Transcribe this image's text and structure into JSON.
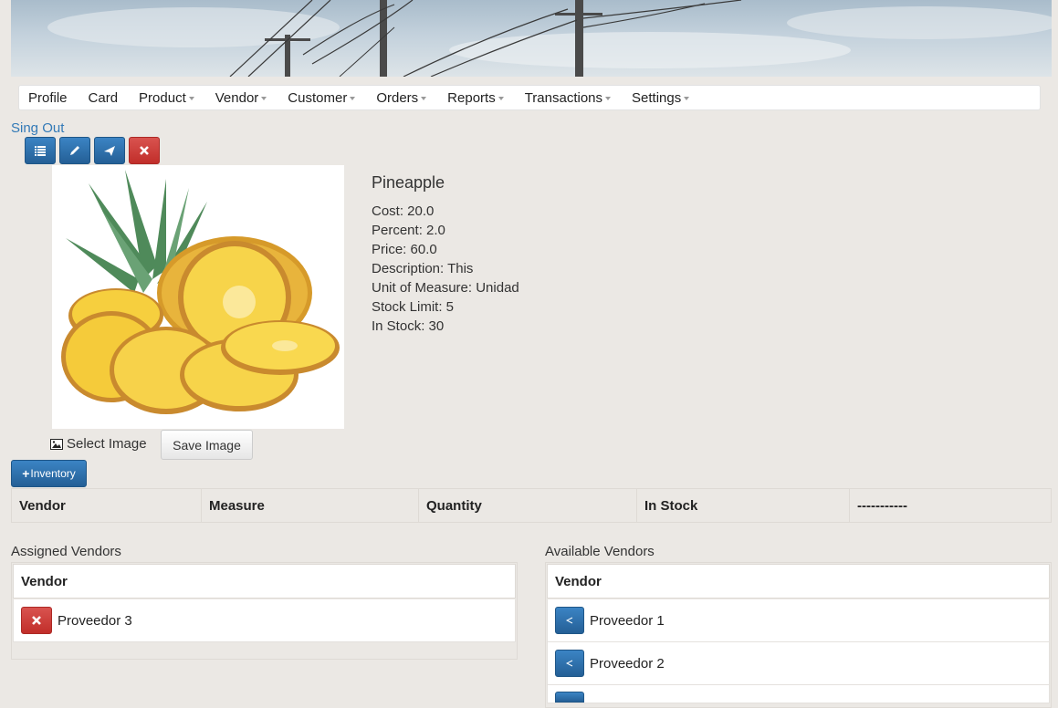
{
  "nav": {
    "items": [
      {
        "label": "Profile",
        "dropdown": false
      },
      {
        "label": "Card",
        "dropdown": false
      },
      {
        "label": "Product",
        "dropdown": true
      },
      {
        "label": "Vendor",
        "dropdown": true
      },
      {
        "label": "Customer",
        "dropdown": true
      },
      {
        "label": "Orders",
        "dropdown": true
      },
      {
        "label": "Reports",
        "dropdown": true
      },
      {
        "label": "Transactions",
        "dropdown": true
      },
      {
        "label": "Settings",
        "dropdown": true
      }
    ]
  },
  "signout_label": "Sing Out",
  "toolbar": {
    "list_icon": "list-icon",
    "edit_icon": "pencil-icon",
    "send_icon": "send-icon",
    "delete_icon": "close-icon"
  },
  "product": {
    "name": "Pineapple",
    "cost": "Cost: 20.0",
    "percent": "Percent: 2.0",
    "price": "Price: 60.0",
    "description": "Description: This",
    "unit": "Unit of Measure: Unidad",
    "stock_limit": "Stock Limit: 5",
    "in_stock": "In Stock: 30"
  },
  "image_actions": {
    "select_label": "Select Image",
    "save_label": "Save Image"
  },
  "inventory": {
    "button_label": "Inventory",
    "columns": [
      "Vendor",
      "Measure",
      "Quantity",
      "In Stock",
      "-----------"
    ]
  },
  "assigned": {
    "title": "Assigned Vendors",
    "header": "Vendor",
    "rows": [
      "Proveedor 3"
    ]
  },
  "available": {
    "title": "Available Vendors",
    "header": "Vendor",
    "rows": [
      "Proveedor 1",
      "Proveedor 2"
    ]
  },
  "colors": {
    "primary": "#2a6aa8",
    "danger": "#d9534f",
    "link": "#337ab7",
    "background": "#ebe8e4"
  }
}
